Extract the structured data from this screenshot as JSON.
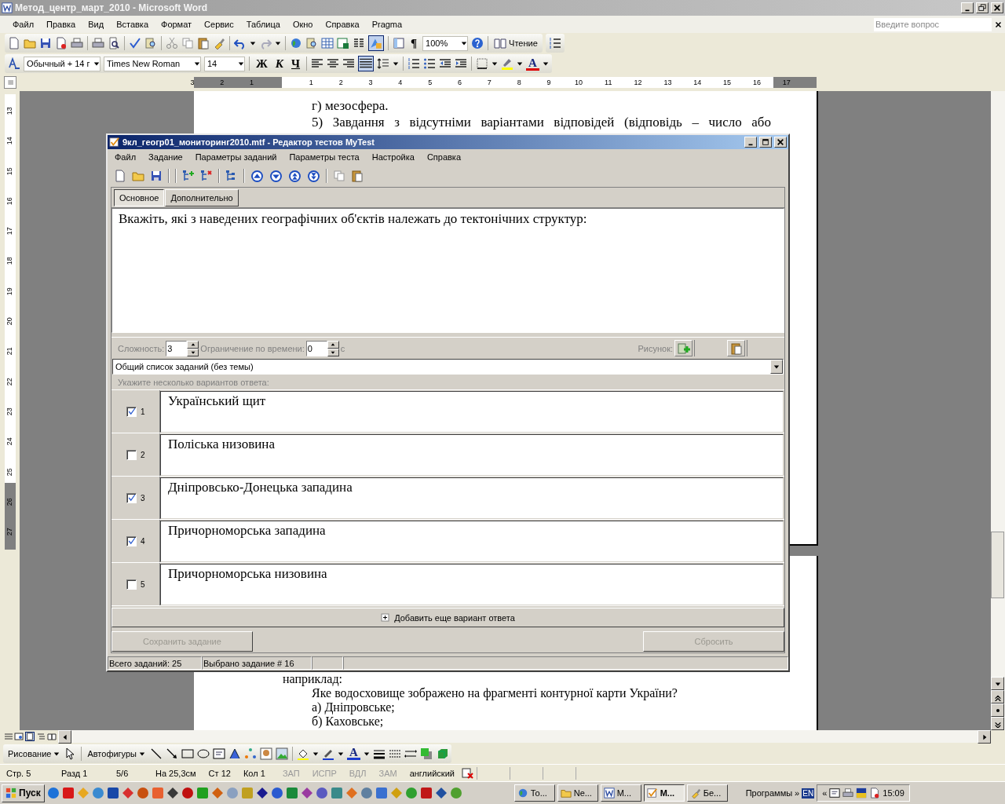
{
  "window": {
    "title": "Метод_центр_март_2010 - Microsoft Word"
  },
  "menu": [
    "Файл",
    "Правка",
    "Вид",
    "Вставка",
    "Формат",
    "Сервис",
    "Таблица",
    "Окно",
    "Справка",
    "Pragma"
  ],
  "help_search": {
    "placeholder": "Введите вопрос"
  },
  "standard_toolbar": {
    "pilcrow": "¶",
    "zoom": "100%",
    "reading": "Чтение"
  },
  "formatting_toolbar": {
    "style": "Обычный + 14 г",
    "font": "Times New Roman",
    "size": "14",
    "bold": "Ж",
    "italic": "К",
    "underline": "Ч",
    "font_color": "А"
  },
  "horizontal_ruler": [
    "3",
    "2",
    "1",
    "1",
    "2",
    "3",
    "4",
    "5",
    "6",
    "7",
    "8",
    "9",
    "10",
    "11",
    "12",
    "13",
    "14",
    "15",
    "16",
    "17"
  ],
  "vertical_ruler": [
    "13",
    "14",
    "15",
    "16",
    "17",
    "18",
    "19",
    "20",
    "21",
    "22",
    "23",
    "24",
    "25",
    "26",
    "27"
  ],
  "document": {
    "page_top_lines": [
      {
        "text": "г) мезосфера.",
        "kind": "item"
      },
      {
        "text": "5) Завдання з відсутніми варіантами відповідей (відповідь – число або",
        "kind": "paragraph"
      }
    ],
    "page_bottom_lines": [
      {
        "text": "наприклад:",
        "kind": "plain"
      },
      {
        "text": "Яке водосховище зображено на фрагменті контурної карти України?",
        "kind": "item"
      },
      {
        "text": "а) Дніпровське;",
        "kind": "item"
      },
      {
        "text": "б) Каховське;",
        "kind": "item"
      }
    ]
  },
  "dialog": {
    "title": "9кл_геогр01_мониторинг2010.mtf - Редактор тестов MyTest",
    "menu": [
      "Файл",
      "Задание",
      "Параметры заданий",
      "Параметры теста",
      "Настройка",
      "Справка"
    ],
    "tabs": [
      {
        "label": "Основное",
        "selected": true
      },
      {
        "label": "Дополнительно",
        "selected": false
      }
    ],
    "question": "Вкажіть, які з наведених географічних об'єктів належать до тектонічних структур:",
    "difficulty_label": "Сложность:",
    "difficulty": "3",
    "time_limit_label": "Ограничение по времени:",
    "time_limit": "0",
    "time_unit": "с",
    "picture_label": "Рисунок:",
    "topic": "Общий список заданий (без темы)",
    "hint": "Укажите несколько вариантов ответа:",
    "answers": [
      {
        "number": "1",
        "text": "Український щит",
        "checked": true
      },
      {
        "number": "2",
        "text": "Поліська низовина",
        "checked": false
      },
      {
        "number": "3",
        "text": "Дніпровсько-Донецька западина",
        "checked": true
      },
      {
        "number": "4",
        "text": "Причорноморська западина",
        "checked": true
      },
      {
        "number": "5",
        "text": "Причорноморська низовина",
        "checked": false
      }
    ],
    "add_button": "Добавить еще вариант ответа",
    "save_button": {
      "label": "Сохранить задание",
      "disabled": true
    },
    "reset_button": {
      "label": "Сбросить",
      "disabled": true
    },
    "status": [
      "Всего заданий: 25",
      "Выбрано задание # 16"
    ]
  },
  "drawing_toolbar": {
    "drawing": "Рисование",
    "autoshapes": "Автофигуры",
    "font_color": "А"
  },
  "status_bar": {
    "fields": [
      "Стр. 5",
      "Разд 1",
      "5/6",
      "На 25,3см",
      "Ст 12",
      "Кол 1"
    ],
    "indicators": [
      {
        "label": "ЗАП",
        "active": false
      },
      {
        "label": "ИСПР",
        "active": false
      },
      {
        "label": "ВДЛ",
        "active": false
      },
      {
        "label": "ЗАМ",
        "active": false
      }
    ],
    "language": "английский"
  },
  "taskbar": {
    "start": "Пуск",
    "tasks": [
      {
        "label": "То...",
        "selected": false
      },
      {
        "label": "Ne...",
        "selected": false
      },
      {
        "label": "М...",
        "selected": false
      },
      {
        "label": "М...",
        "selected": true
      },
      {
        "label": "Бе...",
        "selected": false
      }
    ],
    "toolbar_label": "Программы",
    "chevron": "»",
    "language": "EN",
    "tray_chevron": "«",
    "clock": "15:09"
  }
}
